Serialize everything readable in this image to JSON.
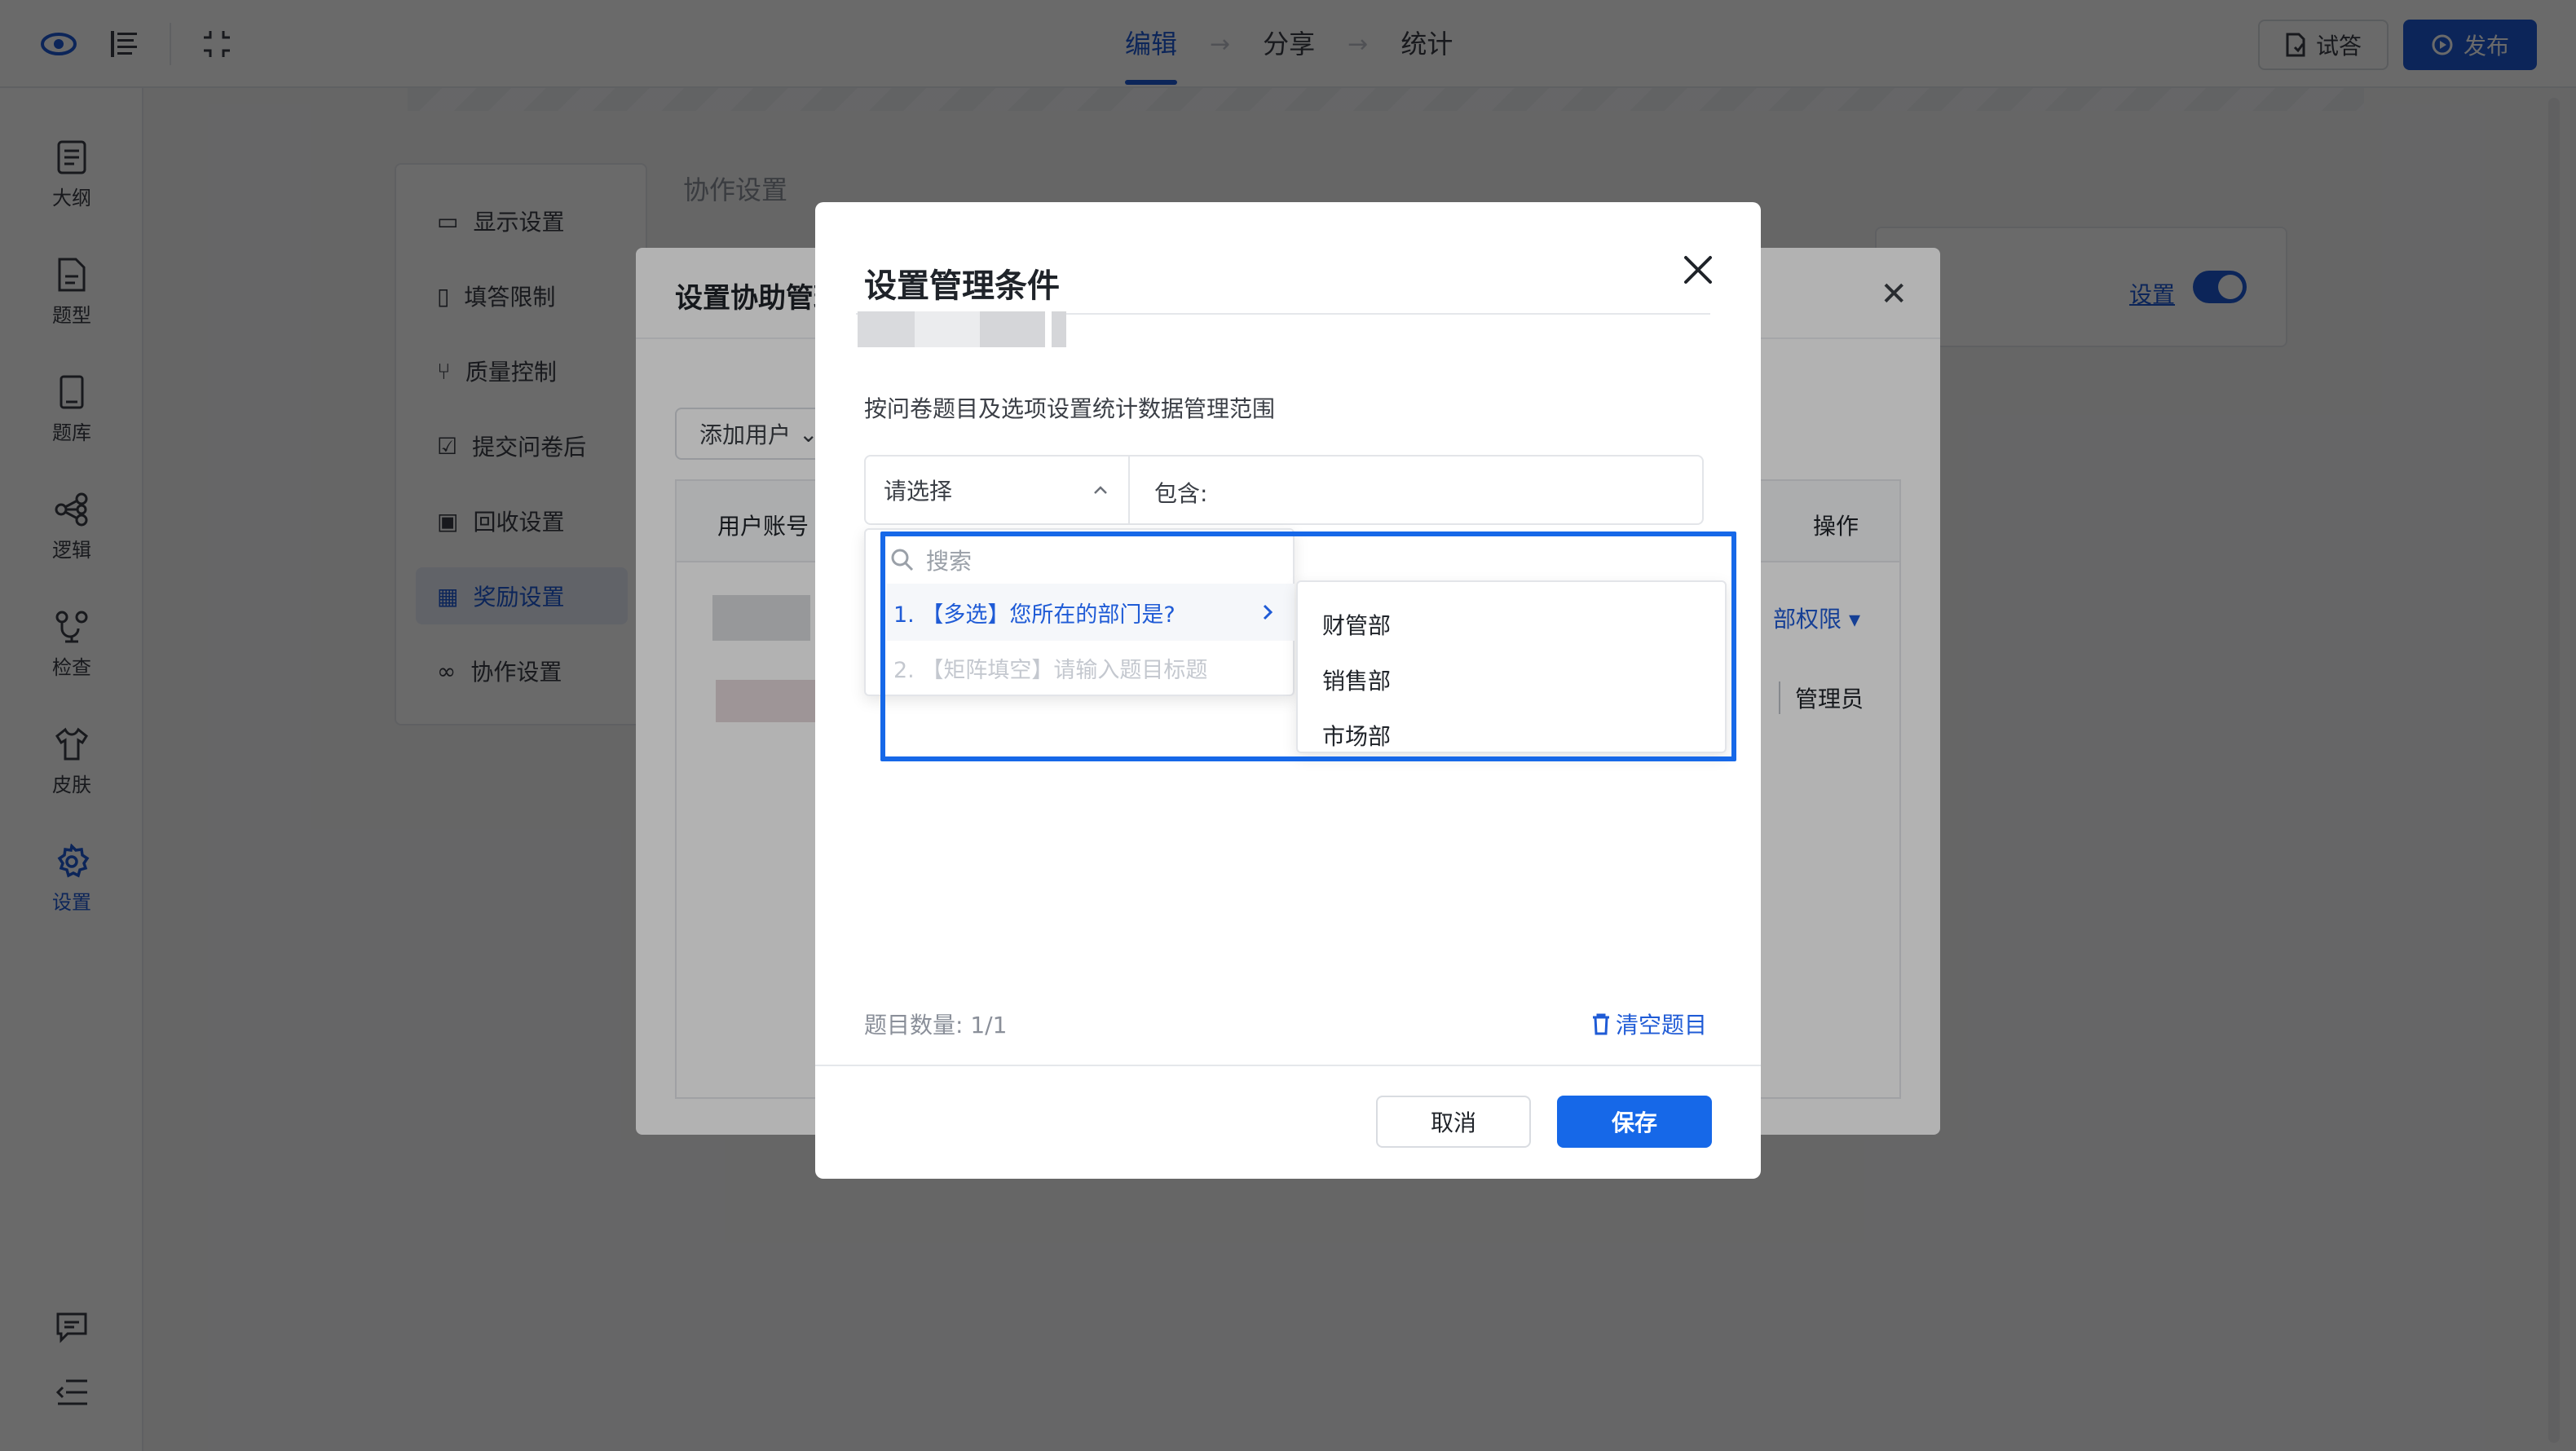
{
  "topbar": {
    "steps": [
      "编辑",
      "分享",
      "统计"
    ],
    "active_step": 0,
    "try_label": "试答",
    "publish_label": "发布",
    "accent": "#1f5bd6"
  },
  "leftnav": {
    "items": [
      {
        "label": "大纲",
        "icon": "outline-icon"
      },
      {
        "label": "题型",
        "icon": "question-type-icon"
      },
      {
        "label": "题库",
        "icon": "question-bank-icon"
      },
      {
        "label": "逻辑",
        "icon": "logic-icon"
      },
      {
        "label": "检查",
        "icon": "check-icon"
      },
      {
        "label": "皮肤",
        "icon": "skin-icon"
      },
      {
        "label": "设置",
        "icon": "gear-icon"
      }
    ],
    "active": 6
  },
  "settings_menu": {
    "items": [
      "显示设置",
      "填答限制",
      "质量控制",
      "提交问卷后",
      "回收设置",
      "奖励设置",
      "协作设置"
    ],
    "active": 5
  },
  "collab": {
    "label": "协作设置",
    "setting_link": "设置"
  },
  "back_dialog": {
    "title": "设置协助管理",
    "add_user": "添加用户",
    "col_user": "用户账号",
    "col_op": "操作",
    "perm_link": "部权限",
    "admin": "管理员"
  },
  "dialog": {
    "title": "设置管理条件",
    "description": "按问卷题目及选项设置统计数据管理范围",
    "select_placeholder": "请选择",
    "contain_label": "包含:",
    "search_placeholder": "搜索",
    "options": [
      "1. 【多选】您所在的部门是?",
      "2. 【矩阵填空】请输入题目标题"
    ],
    "sub_options": [
      "财管部",
      "销售部",
      "市场部"
    ],
    "count_label": "题目数量: 1/1",
    "clear_label": "清空题目",
    "cancel": "取消",
    "save": "保存",
    "save_color": "#1668e8"
  }
}
